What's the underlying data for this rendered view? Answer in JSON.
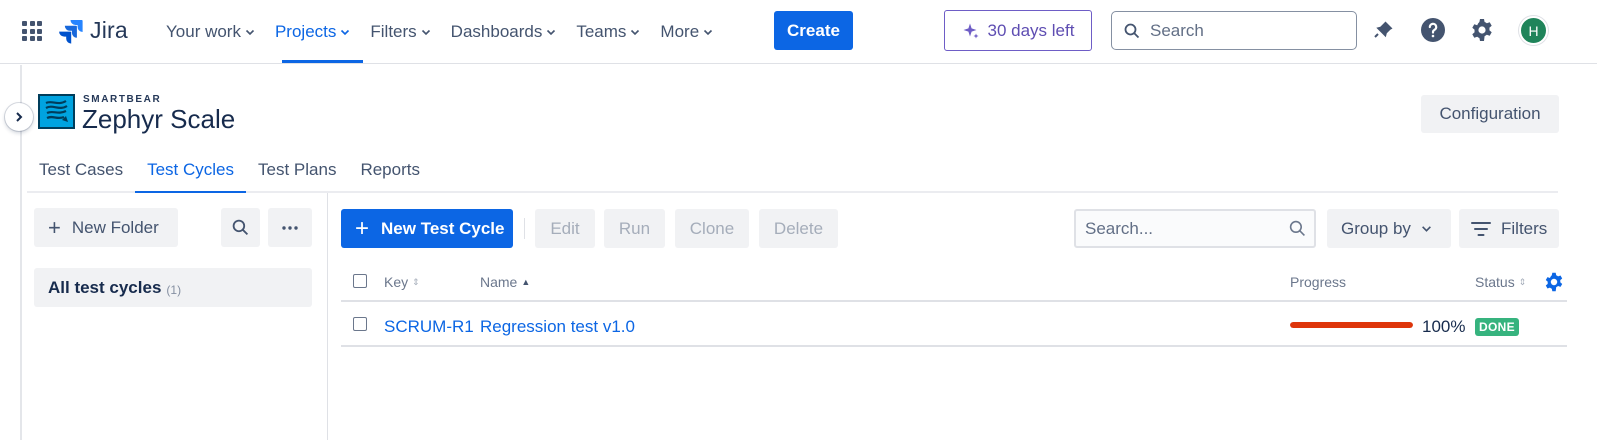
{
  "topnav": {
    "logo_text": "Jira",
    "items": [
      {
        "label": "Your work"
      },
      {
        "label": "Projects"
      },
      {
        "label": "Filters"
      },
      {
        "label": "Dashboards"
      },
      {
        "label": "Teams"
      },
      {
        "label": "More"
      }
    ],
    "active_item": "Projects",
    "create_label": "Create",
    "trial_label": "30 days left",
    "search_placeholder": "Search",
    "avatar_initial": "H",
    "colors": {
      "accent": "#0c66e4",
      "trial": "#5e4db2",
      "avatar": "#1f845a"
    }
  },
  "product": {
    "brand_small": "SMARTBEAR",
    "brand_name": "Zephyr Scale",
    "config_label": "Configuration"
  },
  "tabs": [
    {
      "label": "Test Cases"
    },
    {
      "label": "Test Cycles"
    },
    {
      "label": "Test Plans"
    },
    {
      "label": "Reports"
    }
  ],
  "active_tab": "Test Cycles",
  "folders": {
    "new_folder_label": "New Folder",
    "all_label": "All test cycles",
    "all_count": "(1)"
  },
  "toolbar": {
    "new_cycle_label": "New Test Cycle",
    "edit_label": "Edit",
    "run_label": "Run",
    "clone_label": "Clone",
    "delete_label": "Delete",
    "search_placeholder": "Search...",
    "groupby_label": "Group by",
    "filters_label": "Filters"
  },
  "table": {
    "headers": {
      "key": "Key",
      "name": "Name",
      "progress": "Progress",
      "status": "Status"
    },
    "rows": [
      {
        "key": "SCRUM-R1",
        "name": "Regression test v1.0",
        "progress_pct": "100%",
        "progress_value": 1.0,
        "status": "DONE"
      }
    ],
    "colors": {
      "progress_fill": "#de350b",
      "status_done": "#36b37e"
    }
  },
  "icons": [
    "app-switcher-icon",
    "jira-logo-icon",
    "chevron-down-icon",
    "sparkle-icon",
    "search-icon",
    "notification-icon",
    "help-icon",
    "settings-icon",
    "chevron-right-icon",
    "zephyr-logo-icon",
    "more-icon",
    "filter-icon",
    "column-settings-icon"
  ]
}
